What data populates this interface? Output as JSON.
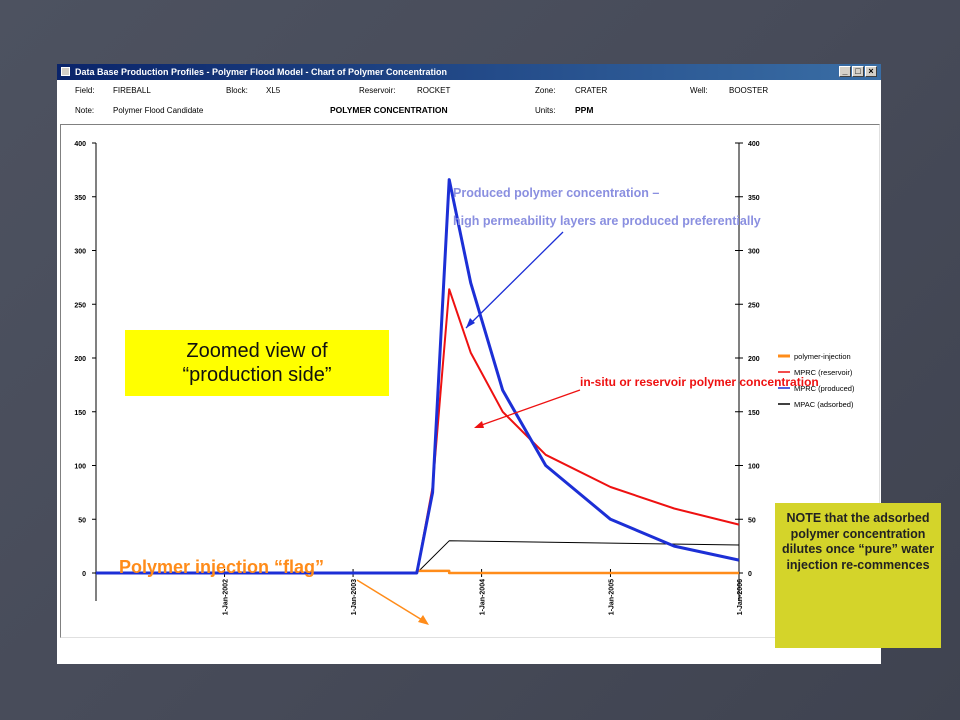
{
  "window": {
    "title": "Data Base Production Profiles - Polymer Flood Model - Chart of Polymer Concentration",
    "min_label": "_",
    "max_label": "□",
    "close_label": "×"
  },
  "info": {
    "field_label": "Field:",
    "field_value": "FIREBALL",
    "block_label": "Block:",
    "block_value": "XL5",
    "reservoir_label": "Reservoir:",
    "reservoir_value": "ROCKET",
    "zone_label": "Zone:",
    "zone_value": "CRATER",
    "well_label": "Well:",
    "well_value": "BOOSTER",
    "note_label": "Note:",
    "note_value": "Polymer Flood Candidate",
    "chart_title": "POLYMER CONCENTRATION",
    "units_label": "Units:",
    "units_value": "PPM"
  },
  "chart_data": {
    "type": "line",
    "title": "POLYMER CONCENTRATION",
    "ylabel": "",
    "xlabel": "",
    "x_axis": "date",
    "xlim": [
      "2001-01-01",
      "2006-01-01"
    ],
    "ylim": [
      0,
      400
    ],
    "y_ticks": [
      0,
      50,
      100,
      150,
      200,
      250,
      300,
      350,
      400
    ],
    "y_tick_labels": [
      "0",
      "50",
      "100",
      "150",
      "200",
      "250",
      "300",
      "350",
      "400"
    ],
    "x_ticks": [
      "2002-01-01",
      "2003-01-01",
      "2004-01-01",
      "2005-01-01",
      "2006-01-01"
    ],
    "x_tick_labels": [
      "1-Jan-2002",
      "1-Jan-2003",
      "1-Jan-2004",
      "1-Jan-2005",
      "1-Jan-2006"
    ],
    "grid": false,
    "legend": "right",
    "series": [
      {
        "name": "polymer-injection",
        "color": "#ff8c1a",
        "style": "solid",
        "x": [
          "2001-01-01",
          "2003-07-01",
          "2003-07-01",
          "2003-10-01",
          "2003-10-01",
          "2006-01-01"
        ],
        "y": [
          0,
          0,
          2,
          2,
          0,
          0
        ]
      },
      {
        "name": "MPRC (reservoir)",
        "color": "#ee1111",
        "style": "solid",
        "x": [
          "2001-01-01",
          "2003-07-01",
          "2003-08-15",
          "2003-10-01",
          "2003-12-01",
          "2004-03-01",
          "2004-07-01",
          "2005-01-01",
          "2005-07-01",
          "2006-01-01"
        ],
        "y": [
          0,
          0,
          80,
          264,
          205,
          150,
          110,
          80,
          60,
          45
        ]
      },
      {
        "name": "MPRC (produced)",
        "color": "#1c2fd6",
        "style": "solid",
        "x": [
          "2001-01-01",
          "2003-07-01",
          "2003-08-15",
          "2003-10-01",
          "2003-12-01",
          "2004-03-01",
          "2004-07-01",
          "2005-01-01",
          "2005-07-01",
          "2006-01-01"
        ],
        "y": [
          0,
          0,
          75,
          366,
          270,
          170,
          100,
          50,
          25,
          12
        ]
      },
      {
        "name": "MPAC (adsorbed)",
        "color": "#000000",
        "style": "solid",
        "x": [
          "2001-01-01",
          "2003-07-01",
          "2003-10-01",
          "2006-01-01"
        ],
        "y": [
          0,
          0,
          30,
          26
        ]
      }
    ]
  },
  "annotations": {
    "produced_line1": "Produced polymer concentration –",
    "produced_line2": "high permeability layers are produced preferentially",
    "insitu": "in-situ  or reservoir polymer concentration",
    "zoom_line1": "Zoomed view of",
    "zoom_line2": "“production side”",
    "flag": "Polymer injection “flag”",
    "note": "NOTE that the adsorbed polymer concentration dilutes once “pure” water injection re-commences"
  },
  "colors": {
    "title_bar": "#0a246a",
    "annotation_text": "#8a8fe0",
    "insitu_text": "#ee1111",
    "flag_text": "#ff8c1a",
    "zoom_box": "#ffff00",
    "note_box": "#d4d42a"
  }
}
